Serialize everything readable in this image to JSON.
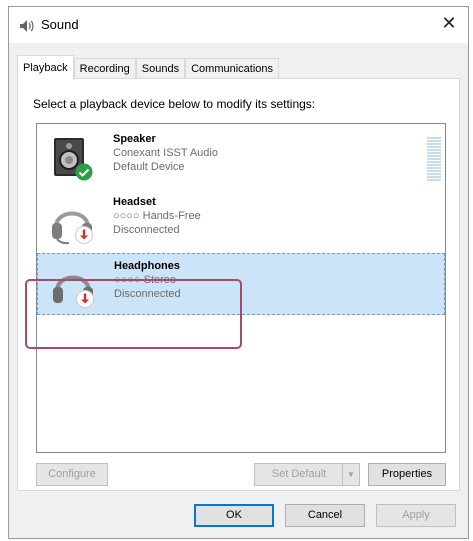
{
  "window": {
    "title": "Sound",
    "close_glyph": "✕"
  },
  "tabs": [
    {
      "label": "Playback",
      "active": true
    },
    {
      "label": "Recording"
    },
    {
      "label": "Sounds"
    },
    {
      "label": "Communications"
    }
  ],
  "instruction": "Select a playback device below to modify its settings:",
  "devices": [
    {
      "name": "Speaker",
      "line1": "Conexant ISST Audio",
      "line2": "Default Device",
      "icon": "speaker-icon",
      "badge": "check-badge-icon",
      "selected": false
    },
    {
      "name": "Headset",
      "line1": "○○○○ Hands-Free",
      "line2": "Disconnected",
      "icon": "headset-icon",
      "badge": "down-arrow-badge-icon",
      "selected": false
    },
    {
      "name": "Headphones",
      "line1": "○○○○ Stereo",
      "line2": "Disconnected",
      "icon": "headphones-icon",
      "badge": "down-arrow-badge-icon",
      "selected": true
    }
  ],
  "buttons": {
    "configure": "Configure",
    "set_default": "Set Default",
    "properties": "Properties",
    "ok": "OK",
    "cancel": "Cancel",
    "apply": "Apply"
  },
  "colors": {
    "selection": "#cce4f7",
    "highlight_outline": "#a84a6e",
    "check_badge": "#2e9e46",
    "down_badge": "#d32f2f"
  }
}
